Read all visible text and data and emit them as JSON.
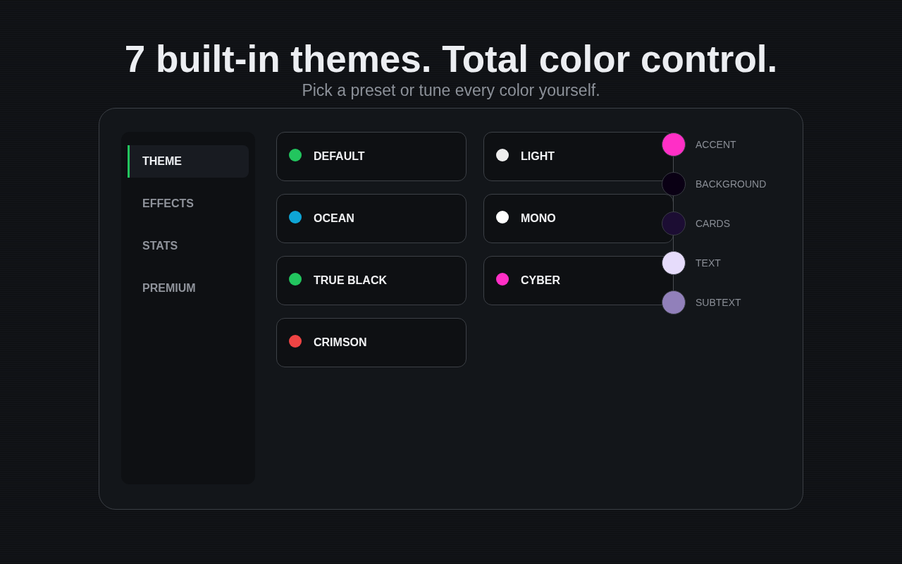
{
  "header": {
    "title": "7 built-in themes. Total color control.",
    "subtitle": "Pick a preset or tune every color yourself."
  },
  "sidebar": {
    "items": [
      {
        "label": "THEME",
        "selected": true
      },
      {
        "label": "EFFECTS",
        "selected": false
      },
      {
        "label": "STATS",
        "selected": false
      },
      {
        "label": "PREMIUM",
        "selected": false
      }
    ]
  },
  "themes": [
    {
      "label": "DEFAULT",
      "color": "#22c55e",
      "selected": false
    },
    {
      "label": "LIGHT",
      "color": "#eeeeee",
      "selected": false
    },
    {
      "label": "OCEAN",
      "color": "#0ea5d6",
      "selected": false
    },
    {
      "label": "MONO",
      "color": "#ffffff",
      "selected": false
    },
    {
      "label": "TRUE BLACK",
      "color": "#22c55e",
      "selected": false
    },
    {
      "label": "CYBER",
      "color": "#ff2fc6",
      "selected": false
    },
    {
      "label": "CRIMSON",
      "color": "#ef4444",
      "selected": false
    }
  ],
  "color_editor": {
    "swatches": [
      {
        "label": "ACCENT",
        "color": "#ff2fc6"
      },
      {
        "label": "BACKGROUND",
        "color": "#0a0014"
      },
      {
        "label": "CARDS",
        "color": "#1c0d33"
      },
      {
        "label": "TEXT",
        "color": "#e6dcfb"
      },
      {
        "label": "SUBTEXT",
        "color": "#9180ba"
      }
    ]
  }
}
